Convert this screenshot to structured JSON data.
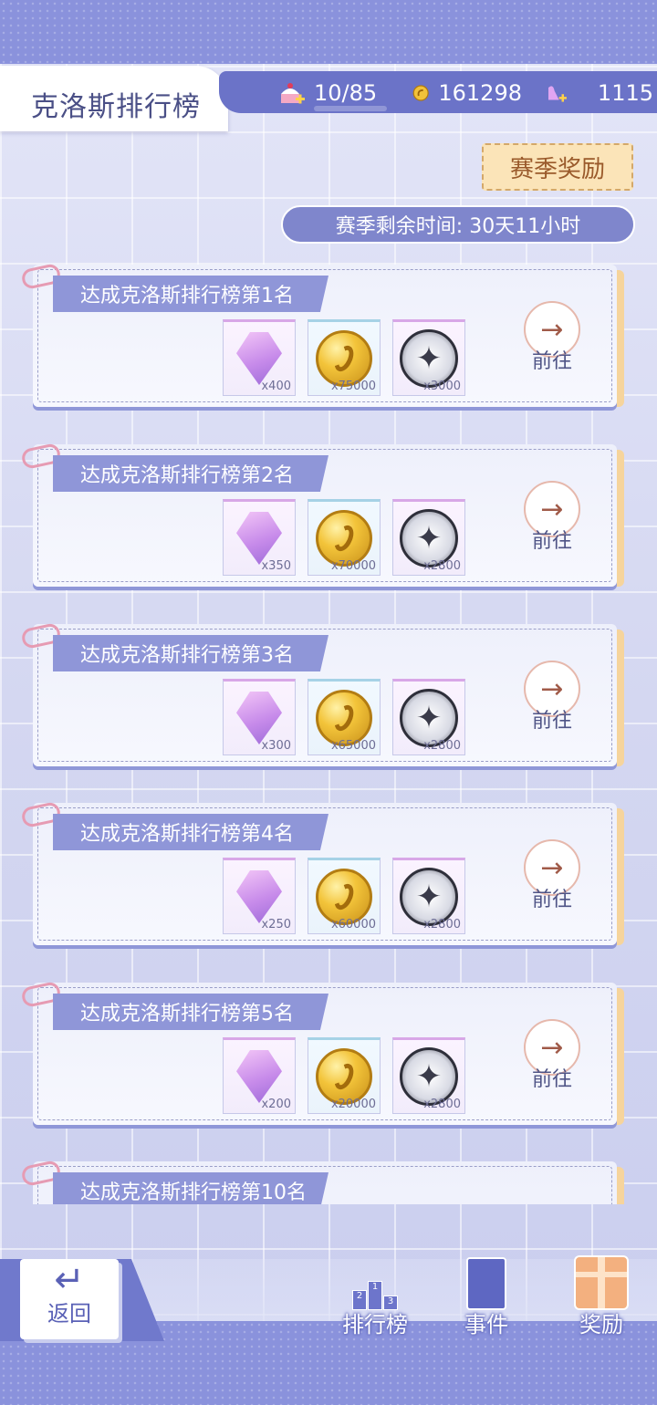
{
  "header": {
    "title": "克洛斯排行榜",
    "resources": [
      {
        "icon": "cake-plus-icon",
        "value": "10/85"
      },
      {
        "icon": "gold-coin-icon",
        "value": "161298"
      },
      {
        "icon": "crystal-swan-plus-icon",
        "value": "1115"
      }
    ]
  },
  "season_reward_label": "赛季奖励",
  "season_timer": "赛季剩余时间: 30天11小时",
  "tasks": [
    {
      "title": "达成克洛斯排行榜第1名",
      "rewards": [
        "x400",
        "x75000",
        "x3000"
      ],
      "go_label": "前往"
    },
    {
      "title": "达成克洛斯排行榜第2名",
      "rewards": [
        "x350",
        "x70000",
        "x2800"
      ],
      "go_label": "前往"
    },
    {
      "title": "达成克洛斯排行榜第3名",
      "rewards": [
        "x300",
        "x65000",
        "x2800"
      ],
      "go_label": "前往"
    },
    {
      "title": "达成克洛斯排行榜第4名",
      "rewards": [
        "x250",
        "x60000",
        "x2800"
      ],
      "go_label": "前往"
    },
    {
      "title": "达成克洛斯排行榜第5名",
      "rewards": [
        "x200",
        "x20000",
        "x2800"
      ],
      "go_label": "前往"
    },
    {
      "title": "达成克洛斯排行榜第10名",
      "rewards": [],
      "go_label": ""
    }
  ],
  "reward_icons": [
    "crystal-swan-icon",
    "gold-coin-icon",
    "compass-token-icon"
  ],
  "bottom_nav": {
    "back_label": "返回",
    "items": [
      {
        "label": "排行榜",
        "icon": "podium-icon"
      },
      {
        "label": "事件",
        "icon": "book-icon"
      },
      {
        "label": "奖励",
        "icon": "gift-box-icon"
      }
    ]
  },
  "colors": {
    "accent": "#8a92dc",
    "card_back": "#f6d49c",
    "title_text": "#4a4f86"
  }
}
